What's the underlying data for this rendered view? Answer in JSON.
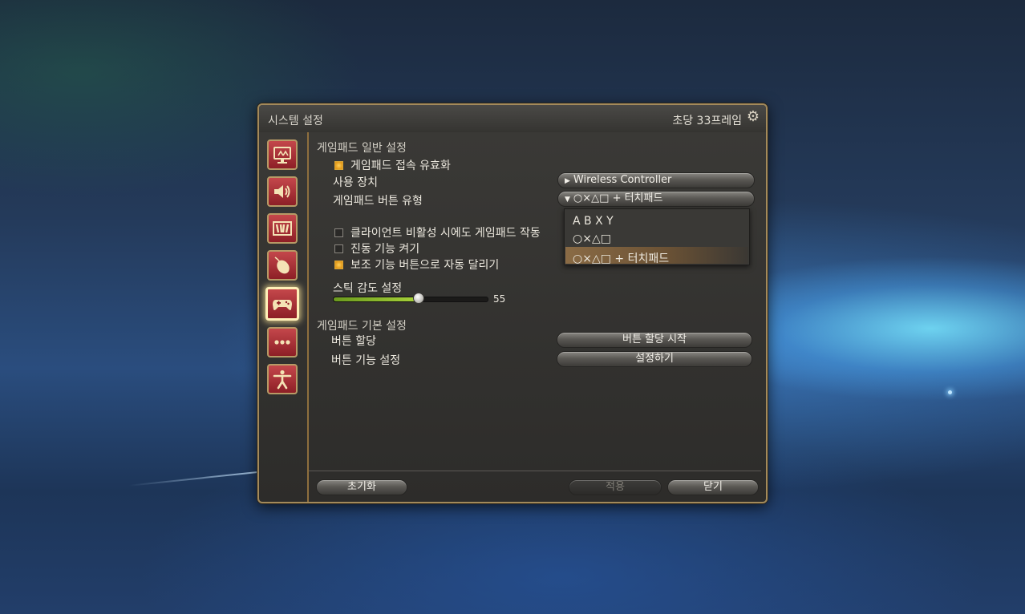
{
  "window": {
    "title": "시스템 설정",
    "fps": "초당 33프레임"
  },
  "sidebar": {
    "items": [
      {
        "icon": "display-icon"
      },
      {
        "icon": "speaker-icon"
      },
      {
        "icon": "theater-icon"
      },
      {
        "icon": "mouse-icon"
      },
      {
        "icon": "gamepad-icon",
        "active": true
      },
      {
        "icon": "more-icon"
      },
      {
        "icon": "accessibility-icon"
      }
    ]
  },
  "general": {
    "title": "게임패드 일반 설정",
    "enable_connection": "게임패드 접속 유효화",
    "device_label": "사용 장치",
    "device_value": "Wireless Controller",
    "button_type_label": "게임패드 버튼 유형",
    "button_type_value": "○×△□ + 터치패드",
    "button_type_options": [
      "A B X Y",
      "○×△□",
      "○×△□ + 터치패드"
    ],
    "inactive_client": "클라이언트 비활성 시에도 게임패드 작동",
    "vibration": "진동 기능 켜기",
    "auto_run": "보조 기능 버튼으로 자동 달리기",
    "stick_label": "스틱 감도 설정",
    "stick_value": "55",
    "stick_fraction": 0.55
  },
  "basic": {
    "title": "게임패드 기본 설정",
    "assign_label": "버튼 할당",
    "assign_button": "버튼 할당 시작",
    "function_label": "버튼 기능 설정",
    "function_button": "설정하기"
  },
  "footer": {
    "reset": "초기화",
    "apply": "적용",
    "close": "닫기"
  },
  "colors": {
    "accent_gold": "#a38a5b",
    "sidebar_red": "#8d1f26",
    "slider_green": "#a8d23a",
    "checkbox_on": "#e39a1c"
  }
}
